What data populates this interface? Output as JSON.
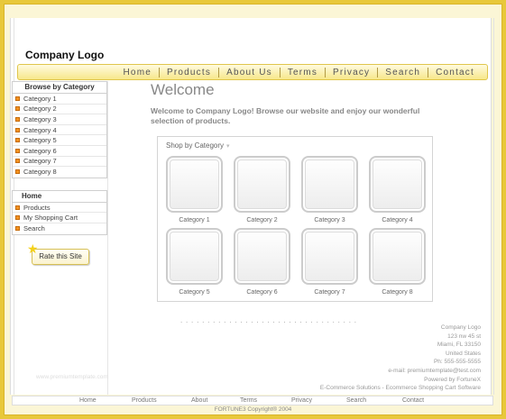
{
  "header": {
    "logo": "Company Logo"
  },
  "topnav": [
    "Home",
    "Products",
    "About Us",
    "Terms",
    "Privacy",
    "Search",
    "Contact"
  ],
  "sidebar": {
    "browse_title": "Browse by Category",
    "categories": [
      "Category 1",
      "Category 2",
      "Category 3",
      "Category 4",
      "Category 5",
      "Category 6",
      "Category 7",
      "Category 8"
    ],
    "menu_title": "Home",
    "menu_items": [
      "Products",
      "My Shopping Cart",
      "Search"
    ],
    "rate_label": "Rate this Site"
  },
  "main": {
    "title": "Welcome",
    "intro": "Welcome to  Company Logo! Browse our website and enjoy our wonderful selection of products.",
    "shop_title": "Shop by Category",
    "products": [
      "Category 1",
      "Category 2",
      "Category 3",
      "Category 4",
      "Category 5",
      "Category 6",
      "Category 7",
      "Category 8"
    ]
  },
  "footer": {
    "address_lines": [
      "Company Logo",
      "123 nw 45 st",
      "Miami, FL 33150",
      "United States",
      "Ph: 555-555-5555",
      "e-mail: premiumtemplate@test.com",
      "Powered by FortuneX",
      "E-Commerce Solutions - Ecommerce Shopping Cart Software"
    ],
    "watermark": "www.premiumtemplate.com",
    "bottomnav": [
      "Home",
      "Products",
      "About",
      "Terms",
      "Privacy",
      "Search",
      "Contact"
    ],
    "copyright": "FORTUNE3 Copyright® 2004"
  },
  "colors": {
    "outer_frame": "#e8c83a",
    "nav_bar": "#f7e78a",
    "bullet": "#f39321"
  }
}
